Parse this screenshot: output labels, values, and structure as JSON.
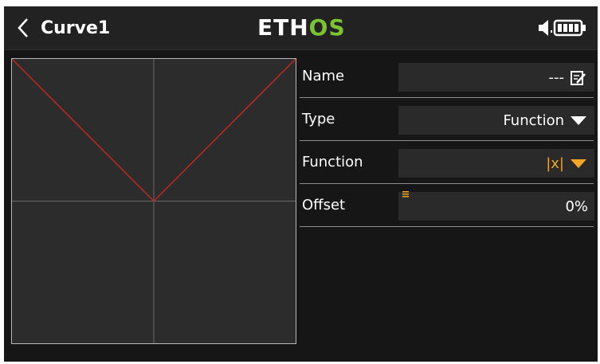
{
  "header": {
    "title": "Curve1",
    "logo_part1": "ETH",
    "logo_part2": "OS"
  },
  "curve": {
    "type": "function",
    "function": "abs",
    "x_range": [
      -100,
      100
    ],
    "y_range": [
      -100,
      100
    ],
    "points": [
      [
        -100,
        100
      ],
      [
        0,
        0
      ],
      [
        100,
        100
      ]
    ],
    "line_color": "#c0281e"
  },
  "fields": {
    "name": {
      "label": "Name",
      "value": "---"
    },
    "type": {
      "label": "Type",
      "value": "Function"
    },
    "function": {
      "label": "Function",
      "value": "|x|"
    },
    "offset": {
      "label": "Offset",
      "value": "0%"
    }
  },
  "colors": {
    "accent_orange": "#f5a623",
    "logo_green": "#7cc331"
  }
}
